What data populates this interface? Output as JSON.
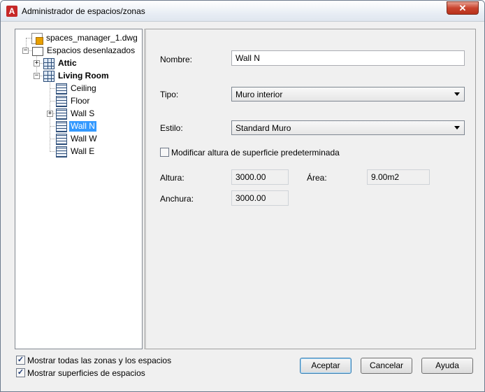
{
  "window": {
    "title": "Administrador de espacios/zonas",
    "close_glyph": "✕",
    "icon_letter": "A"
  },
  "tree": {
    "root_file": "spaces_manager_1.dwg",
    "group": "Espacios desenlazados",
    "nodes": [
      {
        "label": "Attic",
        "bold": true,
        "icon": "space-grid-icon",
        "expander": "+"
      },
      {
        "label": "Living Room",
        "bold": true,
        "icon": "space-grid-icon",
        "expander": "−"
      },
      {
        "label": "Ceiling",
        "icon": "surface-icon"
      },
      {
        "label": "Floor",
        "icon": "surface-icon"
      },
      {
        "label": "Wall S",
        "icon": "surface-icon",
        "expander": "+"
      },
      {
        "label": "Wall N",
        "icon": "surface-icon",
        "selected": true
      },
      {
        "label": "Wall W",
        "icon": "surface-icon"
      },
      {
        "label": "Wall E",
        "icon": "surface-icon"
      }
    ],
    "expander_minus": "−"
  },
  "form": {
    "name_label": "Nombre:",
    "name_value": "Wall N",
    "type_label": "Tipo:",
    "type_value": "Muro interior",
    "style_label": "Estilo:",
    "style_value": "Standard Muro",
    "override_label": "Modificar altura de superficie predeterminada",
    "override_checked": false,
    "height_label": "Altura:",
    "height_value": "3000.00",
    "area_label": "Área:",
    "area_value": "9.00m2",
    "width_label": "Anchura:",
    "width_value": "3000.00"
  },
  "footer": {
    "show_all_label": "Mostrar todas las zonas y los espacios",
    "show_all_checked": true,
    "show_surfaces_label": "Mostrar superficies de espacios",
    "show_surfaces_checked": true,
    "check_glyph": "✓",
    "ok_label": "Aceptar",
    "cancel_label": "Cancelar",
    "help_label": "Ayuda"
  },
  "colors": {
    "selection": "#3399ff",
    "close_button": "#c9442e",
    "app_icon": "#c62828"
  }
}
